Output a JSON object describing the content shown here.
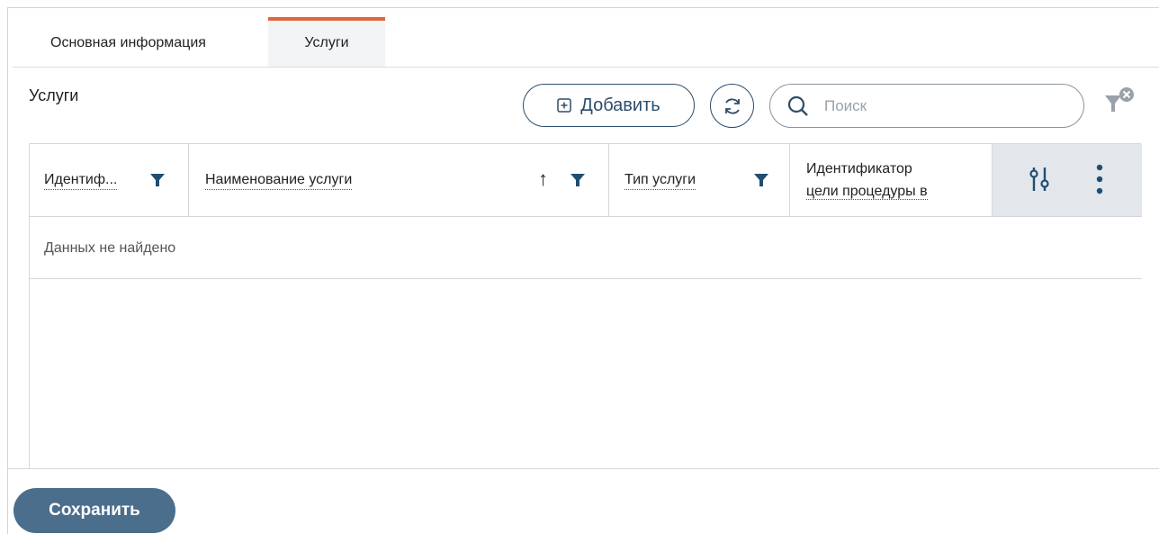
{
  "tabs": {
    "main_info": "Основная информация",
    "services": "Услуги"
  },
  "section": {
    "title": "Услуги"
  },
  "toolbar": {
    "add_label": "Добавить",
    "search_placeholder": "Поиск"
  },
  "table": {
    "columns": [
      {
        "label": "Идентиф..."
      },
      {
        "label": "Наименование услуги",
        "sort": "↑"
      },
      {
        "label": "Тип услуги"
      },
      {
        "label_line1": "Идентификатор",
        "label_line2": "цели процедуры в"
      }
    ],
    "empty_text": "Данных не найдено"
  },
  "footer": {
    "save_label": "Сохранить"
  },
  "colors": {
    "accent": "#2c4d6b",
    "tab_active_border": "#e0663f",
    "save_button": "#4a6e8c"
  }
}
